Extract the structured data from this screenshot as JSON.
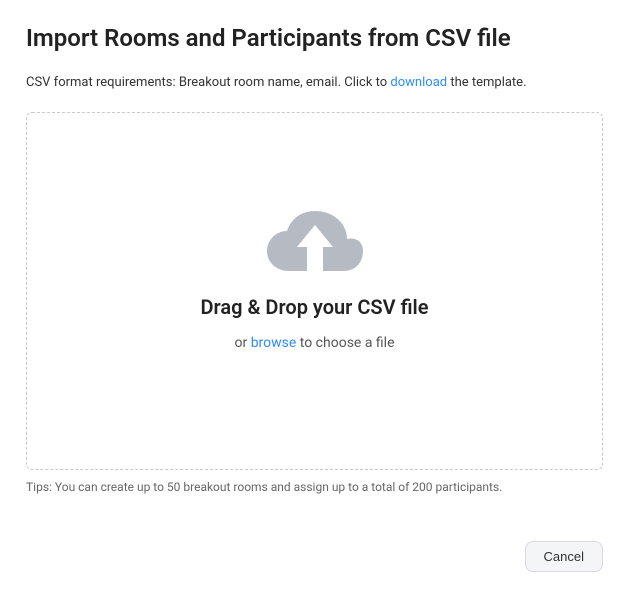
{
  "title": "Import Rooms and Participants from CSV file",
  "desc": {
    "prefix": "CSV format requirements: Breakout room name, email. Click to ",
    "download": "download",
    "suffix": " the template."
  },
  "dropzone": {
    "heading": "Drag & Drop your CSV file",
    "or": "or ",
    "browse": "browse",
    "choose": " to choose a file"
  },
  "tips": "Tips: You can create up to 50 breakout rooms and assign up to a total of 200 participants.",
  "buttons": {
    "cancel": "Cancel"
  }
}
